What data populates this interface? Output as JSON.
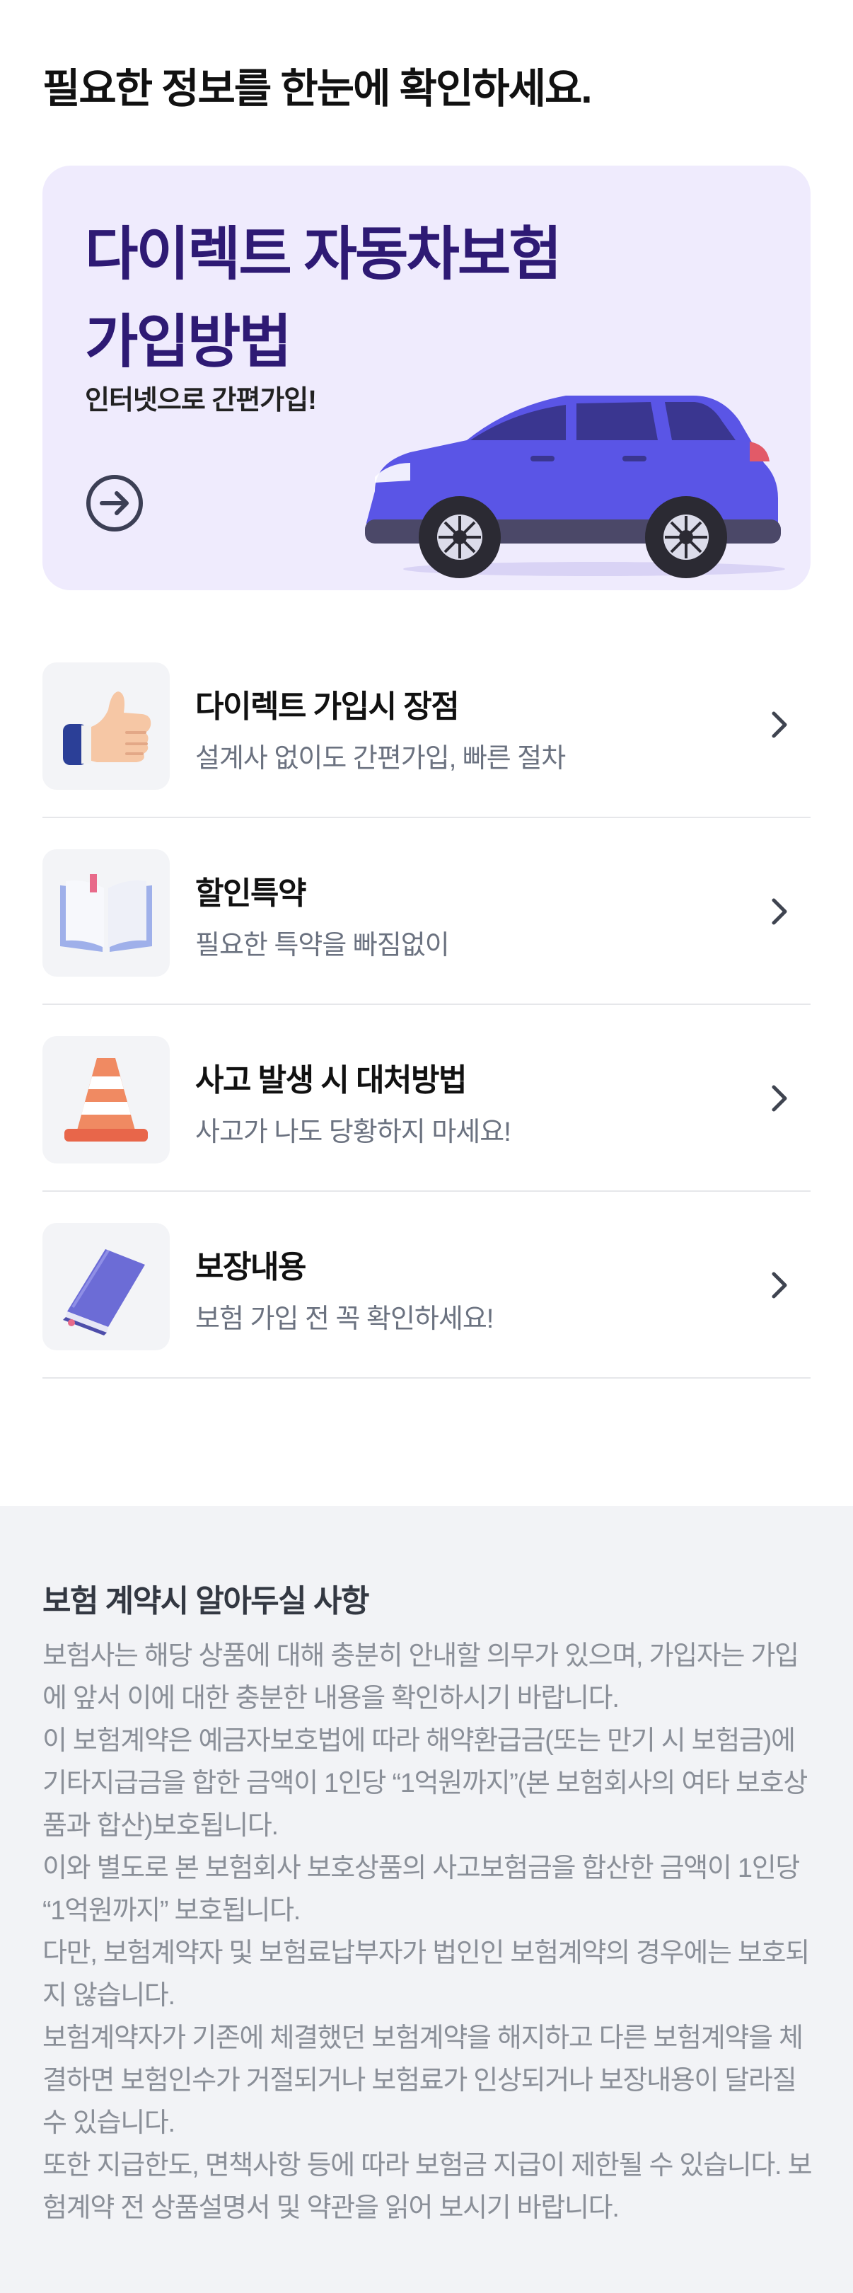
{
  "page": {
    "title": "필요한 정보를 한눈에 확인하세요."
  },
  "banner": {
    "title_line1": "다이렉트 자동차보험",
    "title_line2": "가입방법",
    "subtitle": "인터넷으로 간편가입!",
    "arrow_icon": "arrow-right-circle-icon",
    "illustration": "blue-suv-car",
    "background_color": "#efebfd",
    "title_color": "#2e1a74"
  },
  "menu": {
    "items": [
      {
        "title": "다이렉트 가입시 장점",
        "description": "설계사 없이도 간편가입, 빠른 절차",
        "icon": "thumbs-up-icon"
      },
      {
        "title": "할인특약",
        "description": "필요한 특약을 빠짐없이",
        "icon": "open-book-icon"
      },
      {
        "title": "사고 발생 시 대처방법",
        "description": "사고가 나도 당황하지 마세요!",
        "icon": "traffic-cone-icon"
      },
      {
        "title": "보장내용",
        "description": "보험 가입 전 꼭 확인하세요!",
        "icon": "closed-book-icon"
      }
    ]
  },
  "notice": {
    "title": "보험 계약시 알아두실 사항",
    "paragraphs": [
      "보험사는 해당 상품에 대해 충분히 안내할 의무가 있으며, 가입자는 가입에 앞서 이에 대한 충분한 내용을 확인하시기 바랍니다.",
      "이 보험계약은 예금자보호법에 따라 해약환급금(또는 만기 시 보험금)에 기타지급금을 합한 금액이 1인당 “1억원까지”(본 보험회사의 여타 보호상품과 합산)보호됩니다.",
      "이와 별도로 본 보험회사 보호상품의 사고보험금을 합산한 금액이 1인당 “1억원까지” 보호됩니다.",
      "다만, 보험계약자 및 보험료납부자가 법인인 보험계약의 경우에는 보호되지 않습니다.",
      "보험계약자가 기존에 체결했던 보험계약을 해지하고 다른 보험계약을 체결하면 보험인수가 거절되거나 보험료가 인상되거나 보장내용이 달라질 수 있습니다.",
      "또한 지급한도, 면책사항 등에 따라 보험금 지급이 제한될 수 있습니다. 보험계약 전 상품설명서 및 약관을 읽어 보시기 바랍니다."
    ],
    "background_color": "#f2f3f6"
  }
}
